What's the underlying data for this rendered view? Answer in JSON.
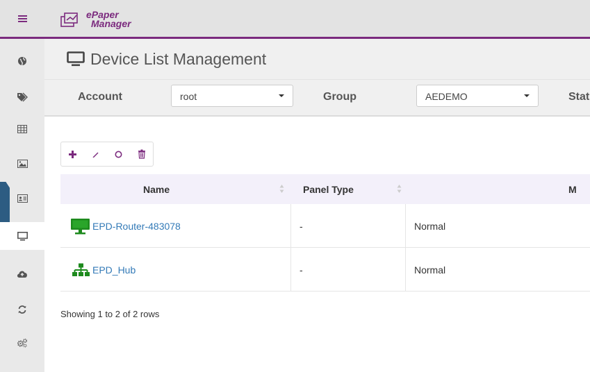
{
  "app": {
    "logo_line1": "ePaper",
    "logo_line2": "Manager",
    "accent_color": "#7b2a7e"
  },
  "sidebar": {
    "items": [
      {
        "icon": "globe-icon"
      },
      {
        "icon": "tags-icon"
      },
      {
        "icon": "table-icon"
      },
      {
        "icon": "image-icon"
      },
      {
        "icon": "id-card-icon"
      },
      {
        "icon": "monitor-icon",
        "active": true
      },
      {
        "icon": "cloud-upload-icon"
      },
      {
        "icon": "refresh-icon"
      },
      {
        "icon": "gears-icon"
      }
    ]
  },
  "page": {
    "title": "Device List Management"
  },
  "filters": {
    "account_label": "Account",
    "account_value": "root",
    "group_label": "Group",
    "group_value": "AEDEMO",
    "status_label": "Stat"
  },
  "toolbar": {
    "buttons": [
      "add-icon",
      "edit-icon",
      "circle-icon",
      "trash-icon"
    ]
  },
  "table": {
    "columns": [
      "Name",
      "Panel Type",
      "",
      "M"
    ],
    "rows": [
      {
        "icon": "monitor-icon",
        "name": "EPD-Router-483078",
        "panel_type": "-",
        "status": "Normal"
      },
      {
        "icon": "network-icon",
        "name": "EPD_Hub",
        "panel_type": "-",
        "status": "Normal"
      }
    ]
  },
  "footer": {
    "text": "Showing 1 to 2 of 2 rows"
  }
}
